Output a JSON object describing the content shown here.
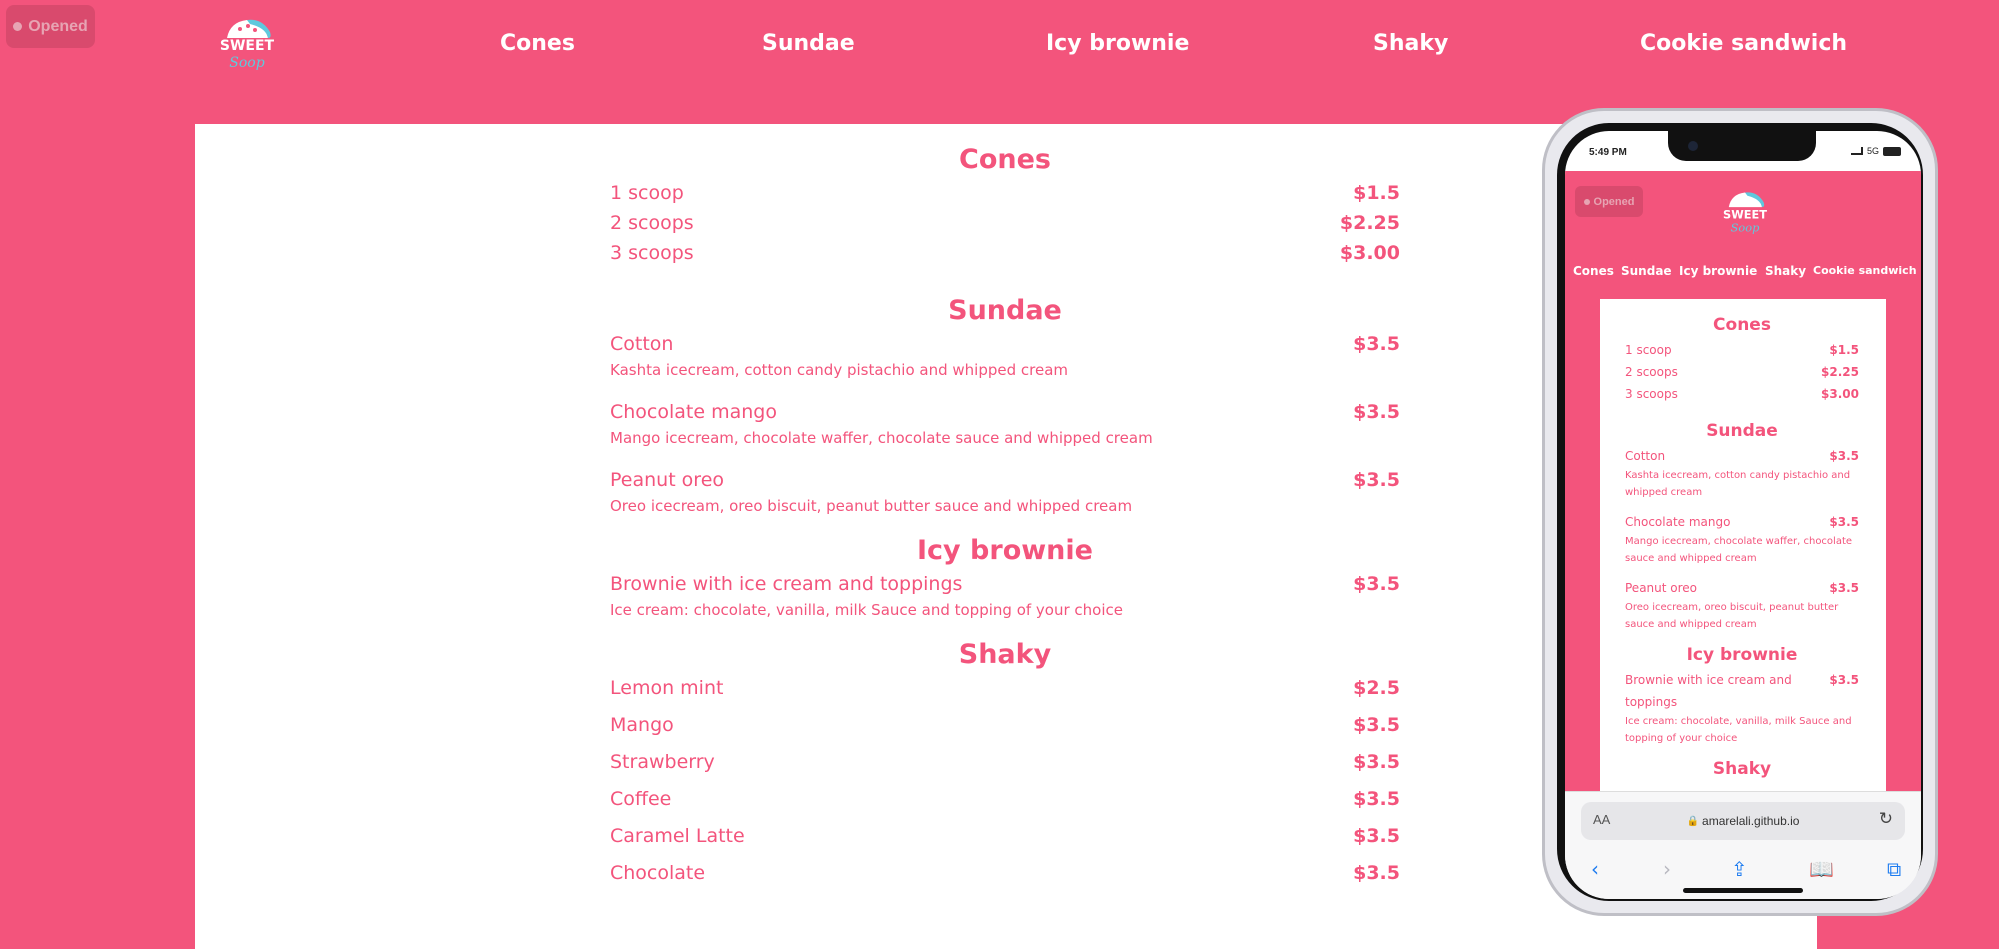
{
  "status": "Opened",
  "logo": {
    "line1": "SWEET",
    "line2": "Soop"
  },
  "nav": [
    "Cones",
    "Sundae",
    "Icy brownie",
    "Shaky",
    "Cookie sandwich"
  ],
  "menu": {
    "cones": {
      "title": "Cones",
      "items": [
        {
          "name": "1 scoop",
          "price": "$1.5"
        },
        {
          "name": "2 scoops",
          "price": "$2.25"
        },
        {
          "name": "3 scoops",
          "price": "$3.00"
        }
      ]
    },
    "sundae": {
      "title": "Sundae",
      "items": [
        {
          "name": "Cotton",
          "price": "$3.5",
          "desc": "Kashta icecream, cotton candy pistachio and whipped cream"
        },
        {
          "name": "Chocolate mango",
          "price": "$3.5",
          "desc": "Mango icecream, chocolate waffer, chocolate sauce and whipped cream"
        },
        {
          "name": "Peanut oreo",
          "price": "$3.5",
          "desc": "Oreo icecream, oreo biscuit, peanut butter sauce and whipped cream"
        }
      ]
    },
    "brownie": {
      "title": "Icy brownie",
      "items": [
        {
          "name": "Brownie with ice cream and toppings",
          "price": "$3.5",
          "desc": "Ice cream: chocolate, vanilla, milk Sauce and topping of your choice"
        }
      ]
    },
    "shaky": {
      "title": "Shaky",
      "items": [
        {
          "name": "Lemon mint",
          "price": "$2.5"
        },
        {
          "name": "Mango",
          "price": "$3.5"
        },
        {
          "name": "Strawberry",
          "price": "$3.5"
        },
        {
          "name": "Coffee",
          "price": "$3.5"
        },
        {
          "name": "Caramel Latte",
          "price": "$3.5"
        },
        {
          "name": "Chocolate",
          "price": "$3.5"
        }
      ]
    }
  },
  "phone": {
    "time": "5:49 PM",
    "network": "5G",
    "url": "amarelali.github.io",
    "aa": "AA",
    "shaky_title_partial": "Shaky"
  },
  "colors": {
    "brand": "#f3547c",
    "badge": "#d94a6d",
    "accent": "#5ec9dd"
  }
}
